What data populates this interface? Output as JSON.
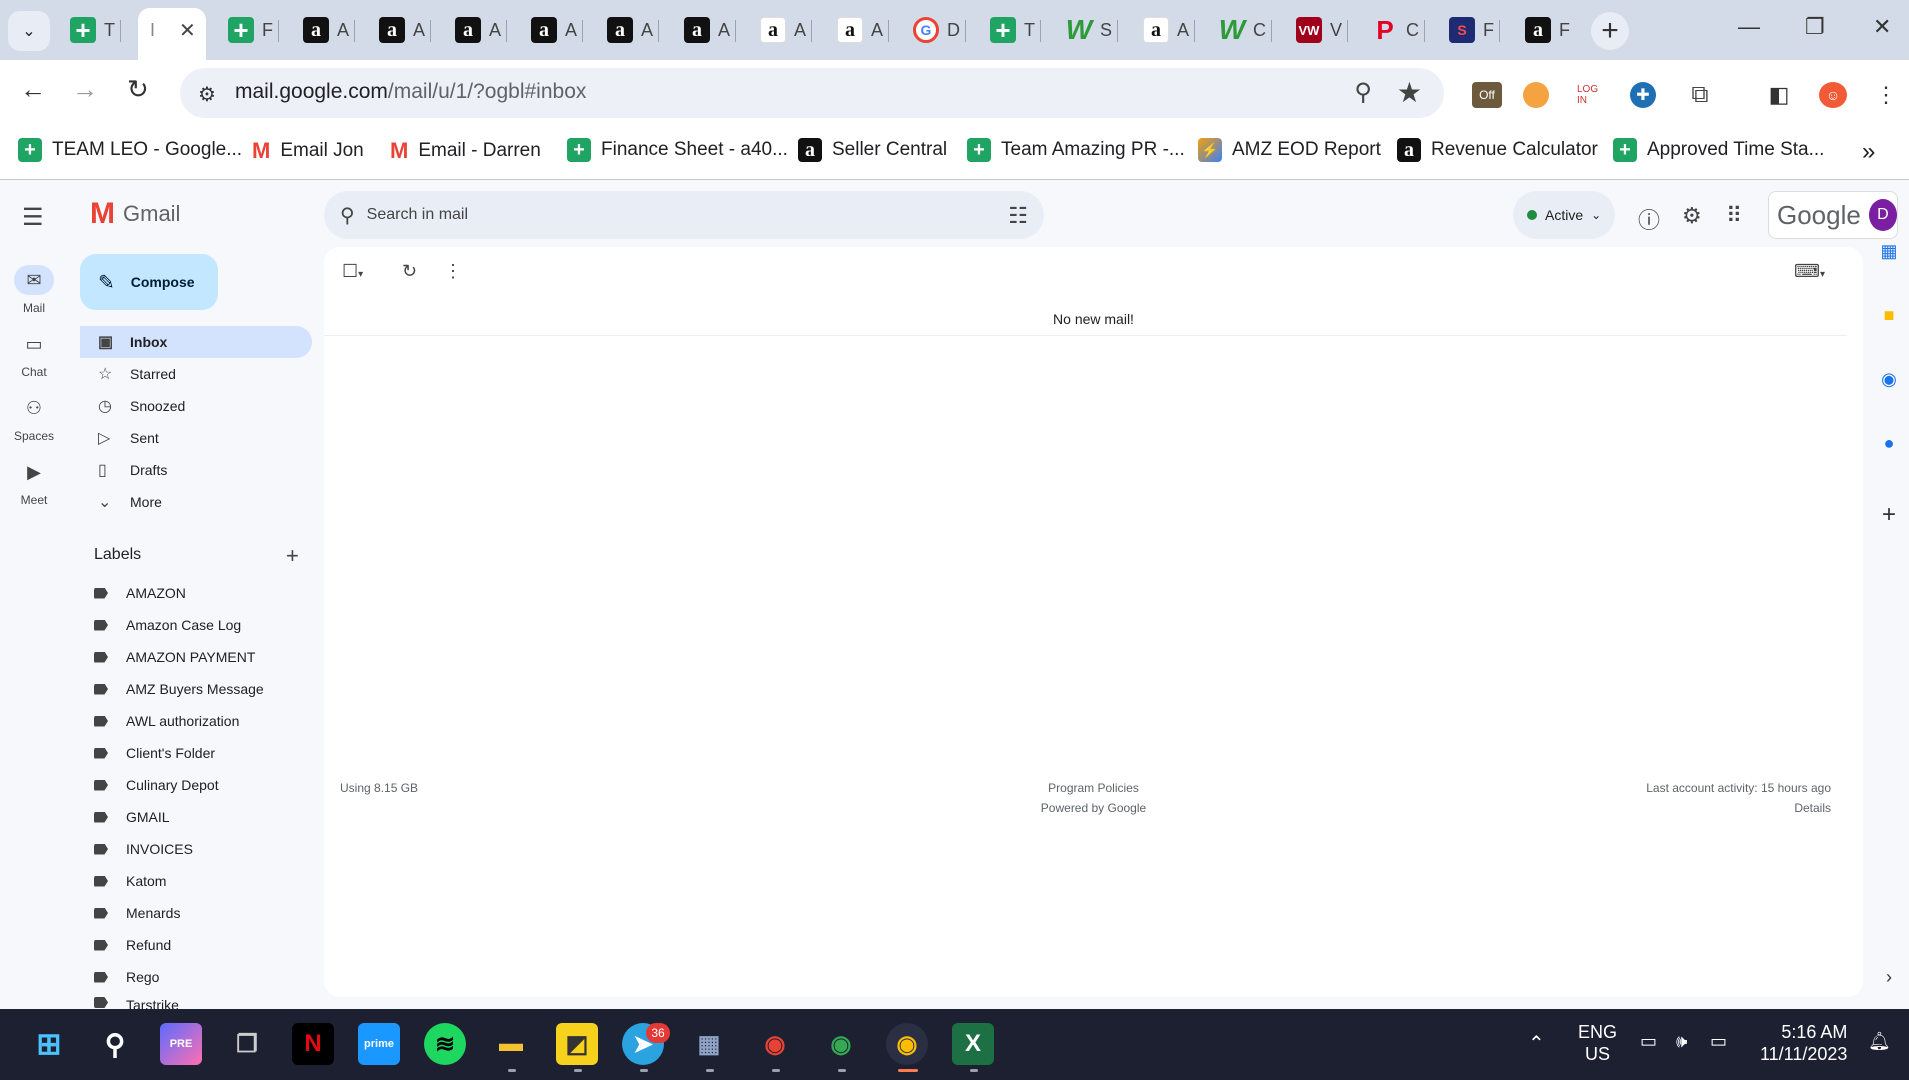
{
  "browser": {
    "tabs": [
      {
        "icon": "sheets",
        "letter": "T"
      },
      {
        "icon": "active",
        "letter": "I"
      },
      {
        "icon": "sheets",
        "letter": "F"
      },
      {
        "icon": "amazon",
        "letter": "A"
      },
      {
        "icon": "amazon",
        "letter": "A"
      },
      {
        "icon": "amazon",
        "letter": "A"
      },
      {
        "icon": "amazon",
        "letter": "A"
      },
      {
        "icon": "amazon",
        "letter": "A"
      },
      {
        "icon": "amazon",
        "letter": "A"
      },
      {
        "icon": "amazon-white",
        "letter": "A"
      },
      {
        "icon": "amazon-white",
        "letter": "A"
      },
      {
        "icon": "google",
        "letter": "D"
      },
      {
        "icon": "sheets",
        "letter": "T"
      },
      {
        "icon": "w",
        "letter": "S"
      },
      {
        "icon": "amazon-white",
        "letter": "A"
      },
      {
        "icon": "w",
        "letter": "C"
      },
      {
        "icon": "vw",
        "letter": "V"
      },
      {
        "icon": "pinterest",
        "letter": "C"
      },
      {
        "icon": "st",
        "letter": "F"
      },
      {
        "icon": "amazon",
        "letter": "F"
      }
    ],
    "address": {
      "host": "mail.google.com",
      "path": "/mail/u/1/?ogbl#inbox"
    },
    "extension_badge": "Off",
    "bookmarks": [
      {
        "icon": "sheets",
        "label": "TEAM LEO - Google..."
      },
      {
        "icon": "gmail",
        "label": "Email Jon"
      },
      {
        "icon": "gmail",
        "label": "Email - Darren"
      },
      {
        "icon": "sheets",
        "label": "Finance Sheet - a40..."
      },
      {
        "icon": "amazon",
        "label": "Seller Central"
      },
      {
        "icon": "sheets",
        "label": "Team Amazing PR -..."
      },
      {
        "icon": "eod",
        "label": "AMZ EOD Report"
      },
      {
        "icon": "amazon",
        "label": "Revenue Calculator"
      },
      {
        "icon": "sheets",
        "label": "Approved Time Sta..."
      }
    ]
  },
  "gmail": {
    "app_name": "Gmail",
    "rail": [
      {
        "label": "Mail"
      },
      {
        "label": "Chat"
      },
      {
        "label": "Spaces"
      },
      {
        "label": "Meet"
      }
    ],
    "compose_label": "Compose",
    "nav": [
      {
        "icon": "inbox-icon",
        "label": "Inbox"
      },
      {
        "icon": "star-icon",
        "label": "Starred"
      },
      {
        "icon": "clock-icon",
        "label": "Snoozed"
      },
      {
        "icon": "send-icon",
        "label": "Sent"
      },
      {
        "icon": "draft-icon",
        "label": "Drafts"
      },
      {
        "icon": "chevron-down-icon",
        "label": "More"
      }
    ],
    "labels_heading": "Labels",
    "labels": [
      "AMAZON",
      "Amazon Case Log",
      "AMAZON PAYMENT",
      "AMZ Buyers Message",
      "AWL authorization",
      "Client's Folder",
      "Culinary Depot",
      "GMAIL",
      "INVOICES",
      "Katom",
      "Menards",
      "Refund",
      "Rego",
      "Tarstrike"
    ],
    "search_placeholder": "Search in mail",
    "status_label": "Active",
    "account_brand": "Google",
    "avatar_letter": "D",
    "empty_message": "No new mail!",
    "footer": {
      "storage": "Using 8.15 GB",
      "policies": "Program Policies",
      "powered": "Powered by Google",
      "activity": "Last account activity: 15 hours ago",
      "details": "Details"
    }
  },
  "taskbar": {
    "telegram_badge": "36",
    "lang_top": "ENG",
    "lang_bottom": "US",
    "time": "5:16 AM",
    "date": "11/11/2023"
  }
}
